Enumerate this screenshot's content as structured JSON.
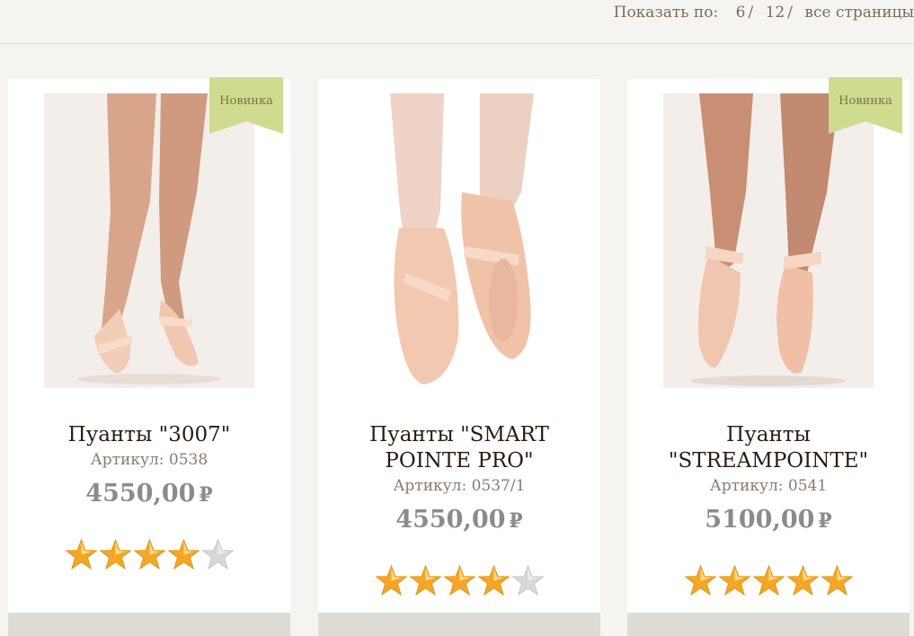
{
  "toolbar": {
    "show_label": "Показать по:",
    "options": [
      "6",
      "12",
      "все страницы"
    ]
  },
  "products": [
    {
      "badge": "Новинка",
      "title_lines": [
        "Пуанты \"3007\""
      ],
      "sku": "Артикул: 0538",
      "price": "4550,00",
      "currency": "₽",
      "rating": 4
    },
    {
      "badge": "",
      "title_lines": [
        "Пуанты \"SMART",
        "POINTE PRO\""
      ],
      "sku": "Артикул: 0537/1",
      "price": "4550,00",
      "currency": "₽",
      "rating": 4
    },
    {
      "badge": "Новинка",
      "title_lines": [
        "Пуанты",
        "\"STREAMPOINTE\""
      ],
      "sku": "Артикул: 0541",
      "price": "5100,00",
      "currency": "₽",
      "rating": 5
    }
  ],
  "colors": {
    "badge_bg": "#cfdb8e",
    "star_full": "#f5a623",
    "star_empty": "#d8d8d8",
    "price": "#8b8b8b"
  }
}
